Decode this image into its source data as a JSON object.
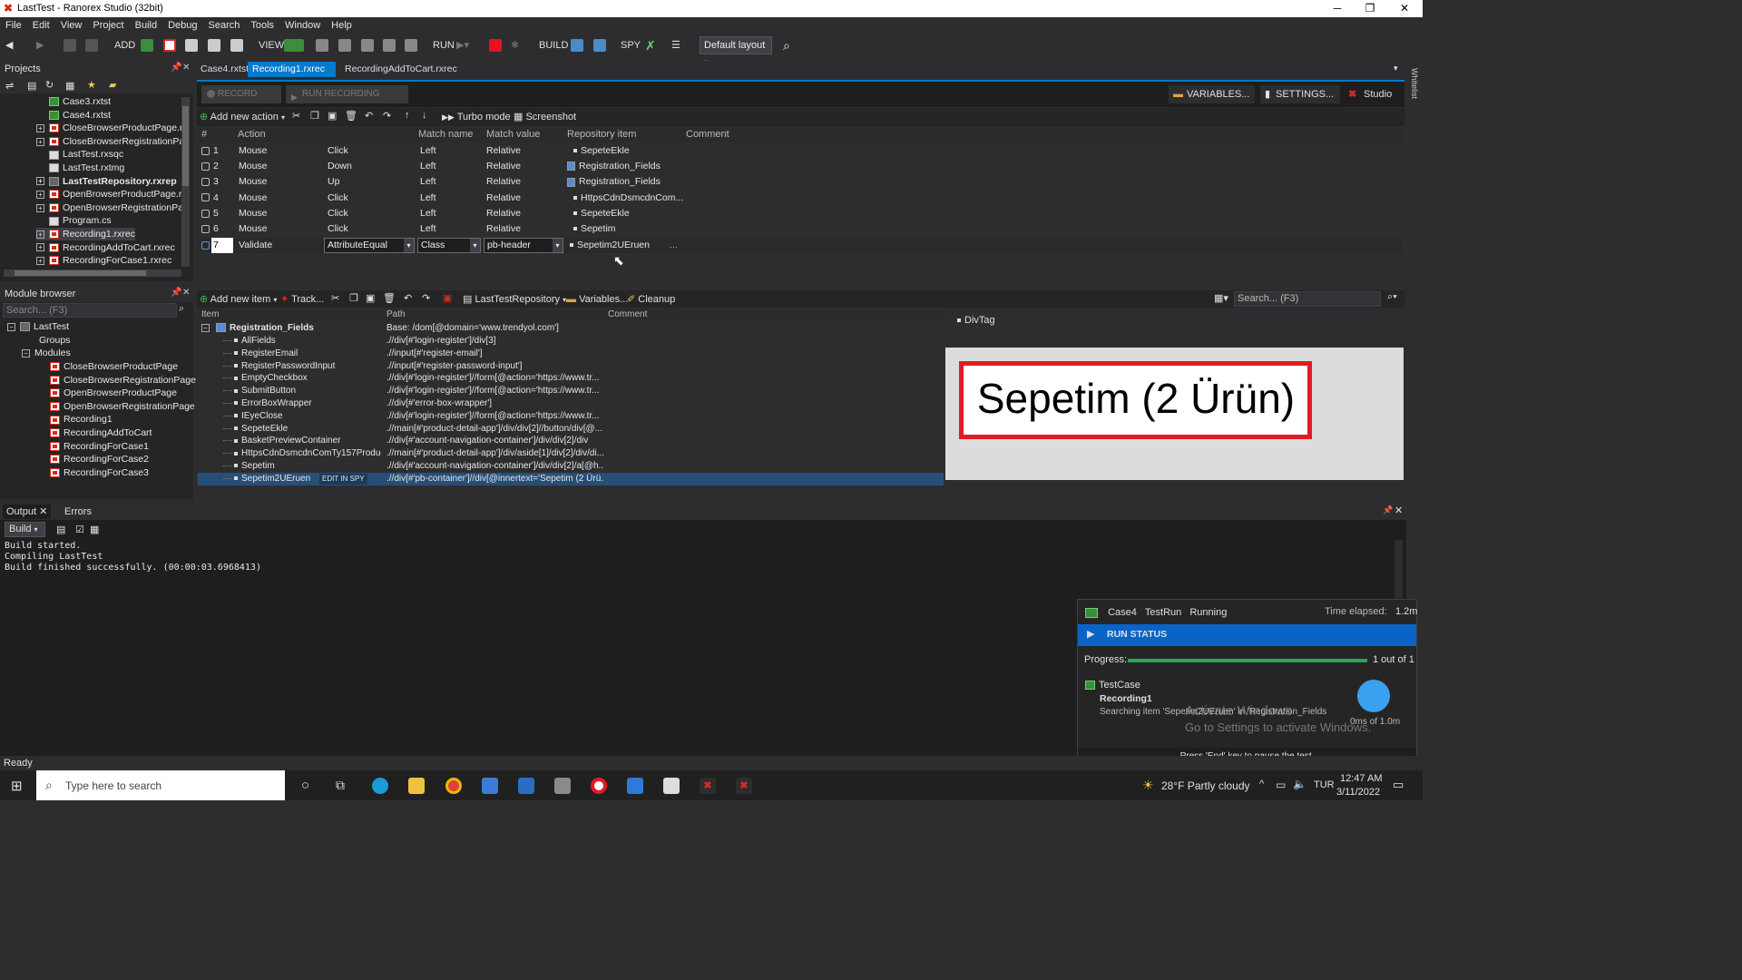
{
  "window": {
    "title": "LastTest - Ranorex Studio (32bit)",
    "minimize": "─",
    "maximize": "❐",
    "close": "✕"
  },
  "menu": [
    "File",
    "Edit",
    "View",
    "Project",
    "Build",
    "Debug",
    "Search",
    "Tools",
    "Window",
    "Help"
  ],
  "toolbar": {
    "add": "ADD",
    "view": "VIEW",
    "run": "RUN",
    "build": "BUILD",
    "spy": "SPY",
    "layout": "Default layout"
  },
  "projects": {
    "title": "Projects",
    "items": [
      {
        "label": "Case3.rxtst",
        "icon": "green",
        "indent": 0,
        "expander": ""
      },
      {
        "label": "Case4.rxtst",
        "icon": "green",
        "indent": 0,
        "expander": ""
      },
      {
        "label": "CloseBrowserProductPage.rxr",
        "icon": "red",
        "indent": 0,
        "expander": "+"
      },
      {
        "label": "CloseBrowserRegistrationPag",
        "icon": "red",
        "indent": 0,
        "expander": "+"
      },
      {
        "label": "LastTest.rxsqc",
        "icon": "doc",
        "indent": 0,
        "expander": ""
      },
      {
        "label": "LastTest.rxtmg",
        "icon": "doc",
        "indent": 0,
        "expander": ""
      },
      {
        "label": "LastTestRepository.rxrep",
        "icon": "gray",
        "indent": 0,
        "expander": "+",
        "bold": true
      },
      {
        "label": "OpenBrowserProductPage.rxr",
        "icon": "red",
        "indent": 0,
        "expander": "+"
      },
      {
        "label": "OpenBrowserRegistrationPag",
        "icon": "red",
        "indent": 0,
        "expander": "+"
      },
      {
        "label": "Program.cs",
        "icon": "doc",
        "indent": 0,
        "expander": ""
      },
      {
        "label": "Recording1.rxrec",
        "icon": "red",
        "indent": 0,
        "expander": "+",
        "selected": true
      },
      {
        "label": "RecordingAddToCart.rxrec",
        "icon": "red",
        "indent": 0,
        "expander": "+"
      },
      {
        "label": "RecordingForCase1.rxrec",
        "icon": "red",
        "indent": 0,
        "expander": "+"
      }
    ]
  },
  "module_browser": {
    "title": "Module browser",
    "search_placeholder": "Search... (F3)",
    "root": "LastTest",
    "groups": "Groups",
    "modules": "Modules",
    "items": [
      "CloseBrowserProductPage",
      "CloseBrowserRegistrationPage",
      "OpenBrowserProductPage",
      "OpenBrowserRegistrationPage",
      "Recording1",
      "RecordingAddToCart",
      "RecordingForCase1",
      "RecordingForCase2",
      "RecordingForCase3"
    ]
  },
  "doc_tabs": [
    {
      "label": "Case4.rxtst",
      "active": false
    },
    {
      "label": "Recording1.rxrec",
      "active": true,
      "close": "✕"
    },
    {
      "label": "RecordingAddToCart.rxrec",
      "active": false
    }
  ],
  "recorder": {
    "record": "RECORD",
    "run_recording": "RUN RECORDING",
    "variables": "VARIABLES...",
    "settings": "SETTINGS...",
    "studio": "Studio",
    "add_new_action": "Add new action",
    "turbo_mode": "Turbo mode",
    "screenshot": "Screenshot",
    "columns": [
      "#",
      "Action",
      "Match name",
      "Match value",
      "Repository item",
      "Comment"
    ],
    "rows": [
      {
        "num": "1",
        "action": "Mouse",
        "type": "Click",
        "button": "Left",
        "relative": "Relative",
        "item": "SepeteEkle",
        "item_icon": "dot"
      },
      {
        "num": "2",
        "action": "Mouse",
        "type": "Down",
        "button": "Left",
        "relative": "Relative",
        "item": "Registration_Fields",
        "item_icon": "doc"
      },
      {
        "num": "3",
        "action": "Mouse",
        "type": "Up",
        "button": "Left",
        "relative": "Relative",
        "item": "Registration_Fields",
        "item_icon": "doc"
      },
      {
        "num": "4",
        "action": "Mouse",
        "type": "Click",
        "button": "Left",
        "relative": "Relative",
        "item": "HttpsCdnDsmcdnCom...",
        "item_icon": "dot"
      },
      {
        "num": "5",
        "action": "Mouse",
        "type": "Click",
        "button": "Left",
        "relative": "Relative",
        "item": "SepeteEkle",
        "item_icon": "dot"
      },
      {
        "num": "6",
        "action": "Mouse",
        "type": "Click",
        "button": "Left",
        "relative": "Relative",
        "item": "Sepetim",
        "item_icon": "dot"
      }
    ],
    "validate_row": {
      "num": "7",
      "action": "Validate",
      "operator": "AttributeEqual",
      "match_name": "Class",
      "match_value": "pb-header",
      "item": "Sepetim2UEruen",
      "more": "..."
    }
  },
  "repository": {
    "add_new_item": "Add new item",
    "track": "Track...",
    "repo_name": "LastTestRepository",
    "variables": "Variables...",
    "cleanup": "Cleanup",
    "search_placeholder": "Search... (F3)",
    "columns": [
      "Item",
      "Path",
      "Comment"
    ],
    "root": {
      "label": "Registration_Fields",
      "path": "Base: /dom[@domain='www.trendyol.com']"
    },
    "items": [
      {
        "label": "AllFields",
        "path": ".//div[#'login-register']/div[3]"
      },
      {
        "label": "RegisterEmail",
        "path": ".//input[#'register-email']"
      },
      {
        "label": "RegisterPasswordInput",
        "path": ".//input[#'register-password-input']"
      },
      {
        "label": "EmptyCheckbox",
        "path": ".//div[#'login-register']//form[@action='https://www.tr..."
      },
      {
        "label": "SubmitButton",
        "path": ".//div[#'login-register']//form[@action='https://www.tr..."
      },
      {
        "label": "ErrorBoxWrapper",
        "path": ".//div[#'error-box-wrapper']"
      },
      {
        "label": "IEyeClose",
        "path": ".//div[#'login-register']//form[@action='https://www.tr..."
      },
      {
        "label": "SepeteEkle",
        "path": ".//main[#'product-detail-app']/div/div[2]//button/div[@..."
      },
      {
        "label": "BasketPreviewContainer",
        "path": ".//div[#'account-navigation-container']/div/div[2]/div"
      },
      {
        "label": "HttpsCdnDsmcdnComTy157Produc...",
        "path": ".//main[#'product-detail-app']/div/aside[1]/div[2]/div/di..."
      },
      {
        "label": "Sepetim",
        "path": ".//div[#'account-navigation-container']/div/div[2]/a[@h..."
      },
      {
        "label": "Sepetim2UEruen",
        "path": ".//div[#'pb-container']//div[@innertext='Sepetim (2 Ürü...",
        "selected": true,
        "edit_in_spy": "EDIT IN SPY"
      }
    ],
    "preview_tag": "DivTag",
    "preview_text": "Sepetim (2 Ürün)"
  },
  "output": {
    "tabs": [
      "Output",
      "Errors"
    ],
    "close": "✕",
    "source": "Build",
    "lines": [
      "Build started.",
      "Compiling LastTest",
      "Build finished successfully. (00:00:03.6968413)"
    ]
  },
  "run_status": {
    "case": "Case4",
    "testrun": "TestRun",
    "state": "Running",
    "elapsed_label": "Time elapsed:",
    "elapsed": "1.2m",
    "header": "RUN STATUS",
    "progress_label": "Progress:",
    "progress_value": 1.0,
    "progress_text": "1 out of 1",
    "testcase": "TestCase",
    "recording": "Recording1",
    "searching": "Searching item 'Sepetim2UEruen' in 'Registration_Fields'",
    "timer": "0ms of 1.0m",
    "hint": "Press 'End' key to pause the test.",
    "watermark1": "Activate Windows",
    "watermark2": "Go to Settings to activate Windows."
  },
  "status_bar": "Ready",
  "taskbar": {
    "search_placeholder": "Type here to search",
    "weather": "28°F  Partly cloudy",
    "lang": "TUR",
    "time": "12:47 AM",
    "date": "3/11/2022"
  },
  "colors": {
    "accent": "#007acc",
    "brand_red": "#d52b1e",
    "progress": "#2ea44f"
  }
}
